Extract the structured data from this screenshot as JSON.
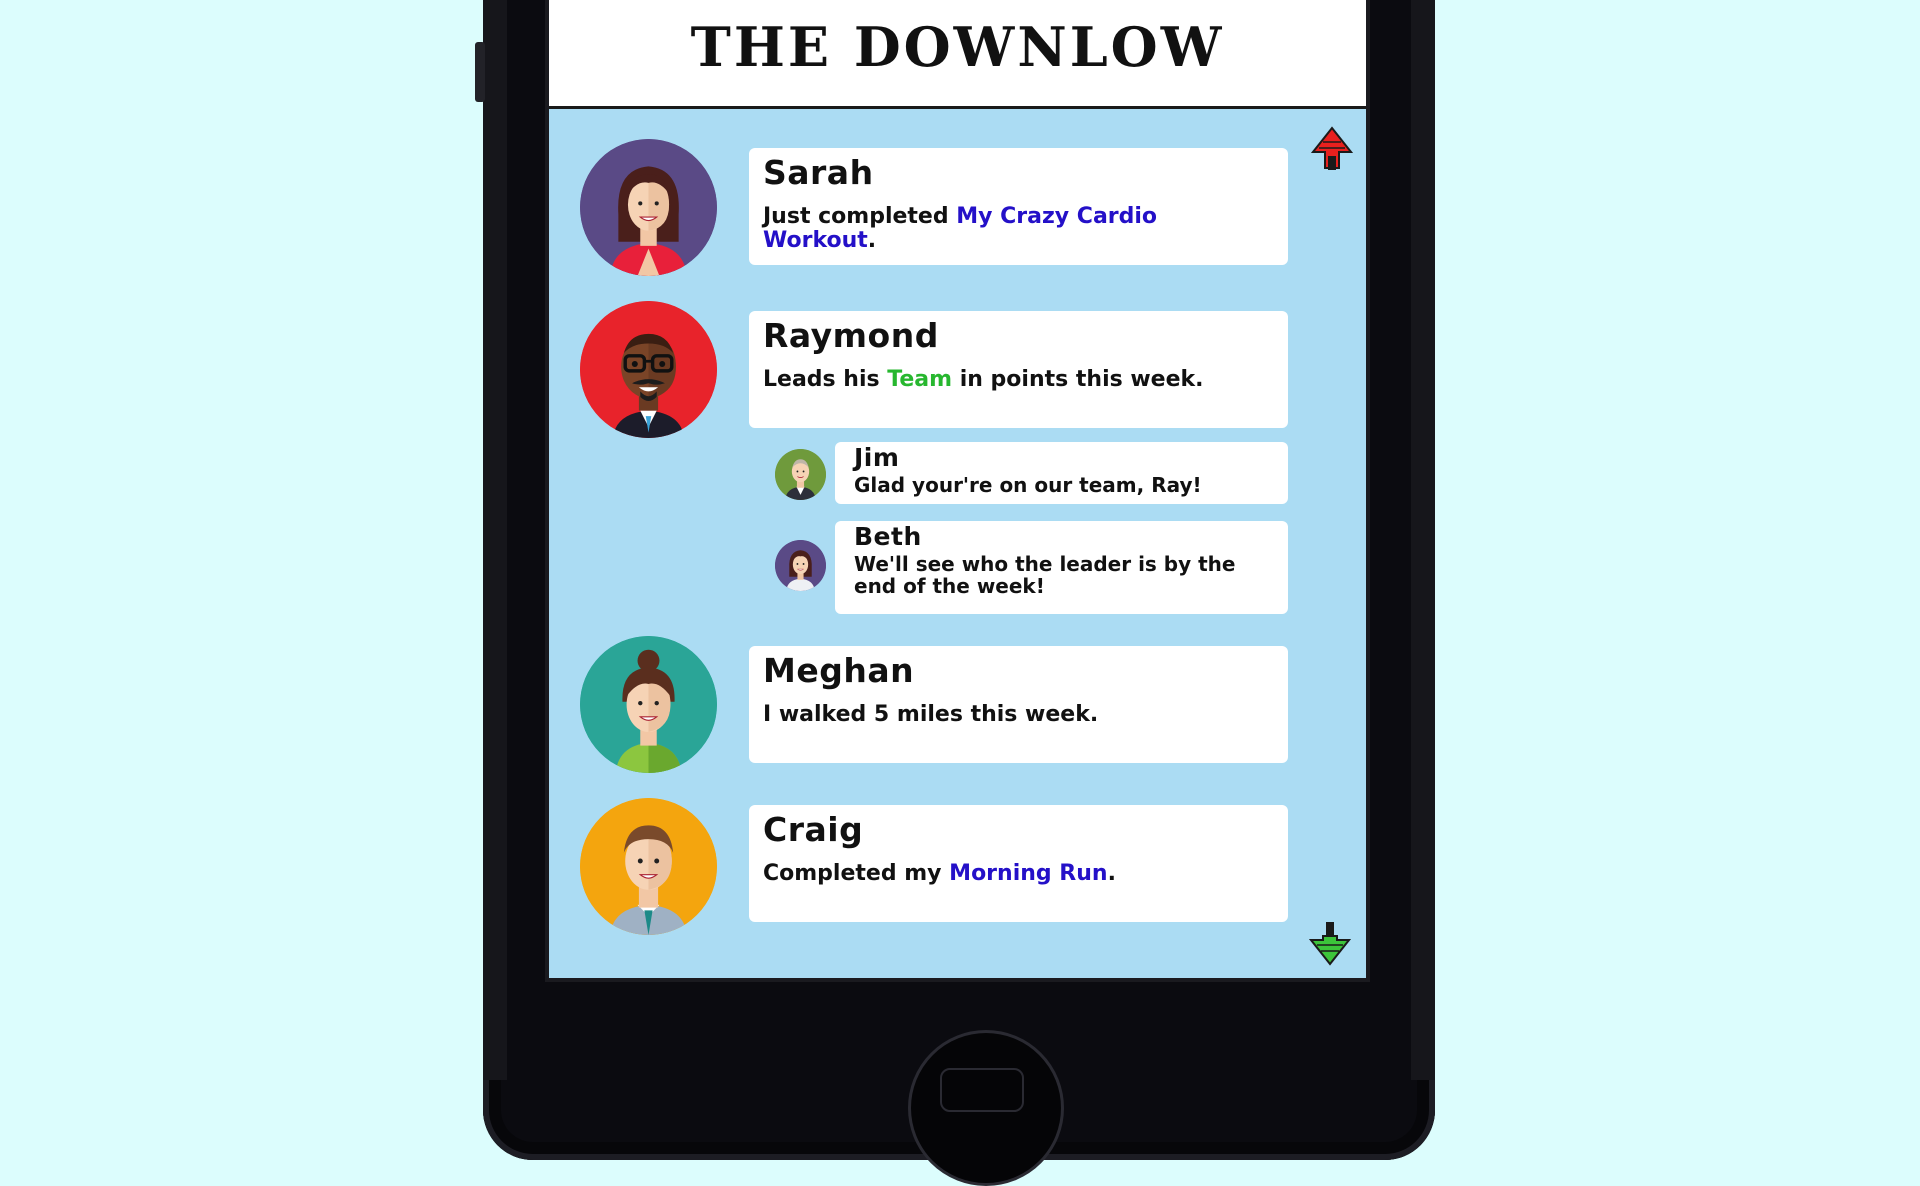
{
  "app": {
    "title": "THE DOWNLOW"
  },
  "colors": {
    "page_background": "#dcfdfd",
    "screen_background": "#abdcf3",
    "link_blue": "#2410c8",
    "link_green": "#27b72f",
    "scroll_up": "#e8201e",
    "scroll_down": "#3cc43a"
  },
  "feed": [
    {
      "name": "Sarah",
      "avatar_icon": "woman-avatar-icon",
      "avatar_color": "#5a4a86",
      "text_before": "Just completed ",
      "link": "My Crazy Cardio Workout",
      "link_color": "blue",
      "text_after": "."
    },
    {
      "name": "Raymond",
      "avatar_icon": "man-glasses-avatar-icon",
      "avatar_color": "#e8232b",
      "text_before": "Leads his ",
      "link": "Team",
      "link_color": "green",
      "text_after": " in points this week.",
      "comments": [
        {
          "name": "Jim",
          "avatar_icon": "man-suit-avatar-icon",
          "avatar_color": "#6f9a3c",
          "text": "Glad your're on our team, Ray!"
        },
        {
          "name": "Beth",
          "avatar_icon": "woman-avatar-icon",
          "avatar_color": "#5a4a86",
          "text": "We'll see who the leader is by the end of the week!"
        }
      ]
    },
    {
      "name": "Meghan",
      "avatar_icon": "woman-bun-avatar-icon",
      "avatar_color": "#2aa597",
      "text_before": "I walked 5 miles this week.",
      "link": "",
      "text_after": ""
    },
    {
      "name": "Craig",
      "avatar_icon": "man-tie-avatar-icon",
      "avatar_color": "#f4a50e",
      "text_before": "Completed my ",
      "link": "Morning Run",
      "link_color": "blue",
      "text_after": "."
    }
  ],
  "controls": {
    "scroll_up_icon": "arrow-up-icon",
    "scroll_down_icon": "arrow-down-icon"
  }
}
